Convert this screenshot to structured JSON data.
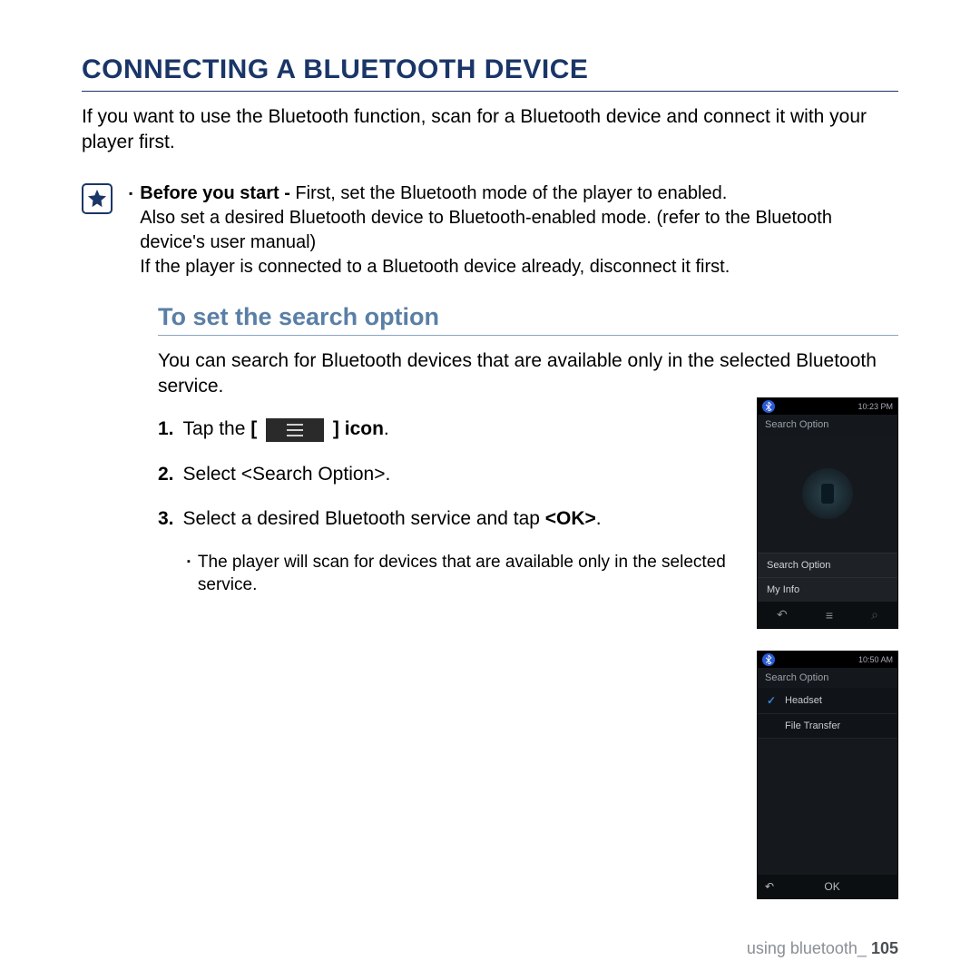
{
  "title": "CONNECTING A BLUETOOTH DEVICE",
  "intro": "If you want to use the Bluetooth function, scan for a Bluetooth device and connect it with your player first.",
  "note": {
    "lead_bold": "Before you start - ",
    "lead_rest": "First, set the Bluetooth mode of the player to enabled.",
    "line2": "Also set a desired Bluetooth device to Bluetooth-enabled mode. (refer to the Bluetooth device's user manual)",
    "line3": "If the player is connected to a Bluetooth device already, disconnect it first."
  },
  "subhead": "To set the search option",
  "sub_intro": "You can search for Bluetooth devices that are available only in the selected Bluetooth service.",
  "steps": {
    "s1_num": "1.",
    "s1_a": "Tap the ",
    "s1_b_open": "[ ",
    "s1_b_close": " ] icon",
    "s1_c": ".",
    "s2_num": "2.",
    "s2": "Select <Search Option>.",
    "s3_num": "3.",
    "s3_a": "Select a desired Bluetooth service and tap ",
    "s3_b": "<OK>",
    "s3_c": "."
  },
  "sub_note": "The player will scan for devices that are available only in the selected service.",
  "phone1": {
    "time": "10:23 PM",
    "header": "Search Option",
    "menu1": "Search Option",
    "menu2": "My Info"
  },
  "phone2": {
    "time": "10:50 AM",
    "header": "Search Option",
    "item1": "Headset",
    "item2": "File Transfer",
    "ok": "OK"
  },
  "footer_label": "using bluetooth_",
  "footer_page": "105"
}
